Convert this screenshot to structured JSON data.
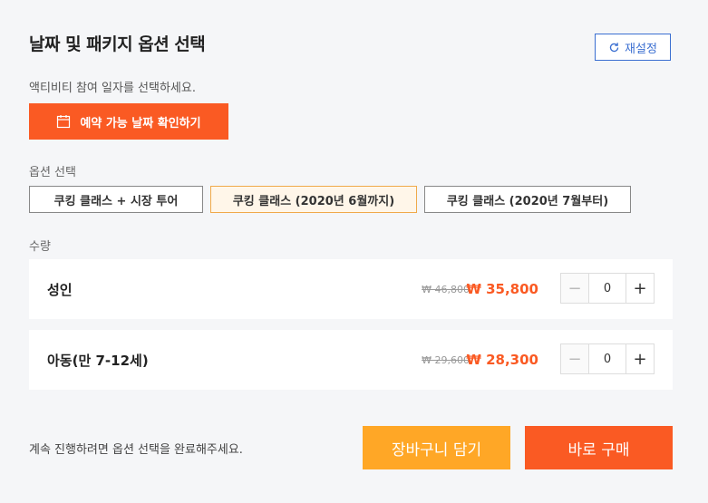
{
  "header": {
    "title": "날짜 및 패키지 옵션 선택",
    "reset_label": "재설정"
  },
  "subtitle": "액티비티 참여 일자를 선택하세요.",
  "date_button": {
    "label": "예약 가능 날짜 확인하기",
    "icon": "calendar-icon"
  },
  "options": {
    "label": "옵션 선택",
    "items": [
      {
        "label": "쿠킹 클래스 + 시장 투어",
        "selected": false
      },
      {
        "label": "쿠킹 클래스 (2020년 6월까지)",
        "selected": true
      },
      {
        "label": "쿠킹 클래스 (2020년 7월부터)",
        "selected": false
      }
    ]
  },
  "quantity": {
    "label": "수량",
    "rows": [
      {
        "name": "성인",
        "old_price": "₩ 46,800",
        "price": "₩ 35,800",
        "count": "0",
        "minus": "−",
        "plus": "+"
      },
      {
        "name": "아동(만 7-12세)",
        "old_price": "₩ 29,600",
        "price": "₩ 28,300",
        "count": "0",
        "minus": "−",
        "plus": "+"
      }
    ]
  },
  "footer": {
    "message": "계속 진행하려면 옵션 선택을 완료해주세요.",
    "cart_label": "장바구니 담기",
    "buy_label": "바로 구매"
  },
  "colors": {
    "accent": "#fa5a23",
    "cart": "#ffa726",
    "link_blue": "#3b6fd1"
  }
}
